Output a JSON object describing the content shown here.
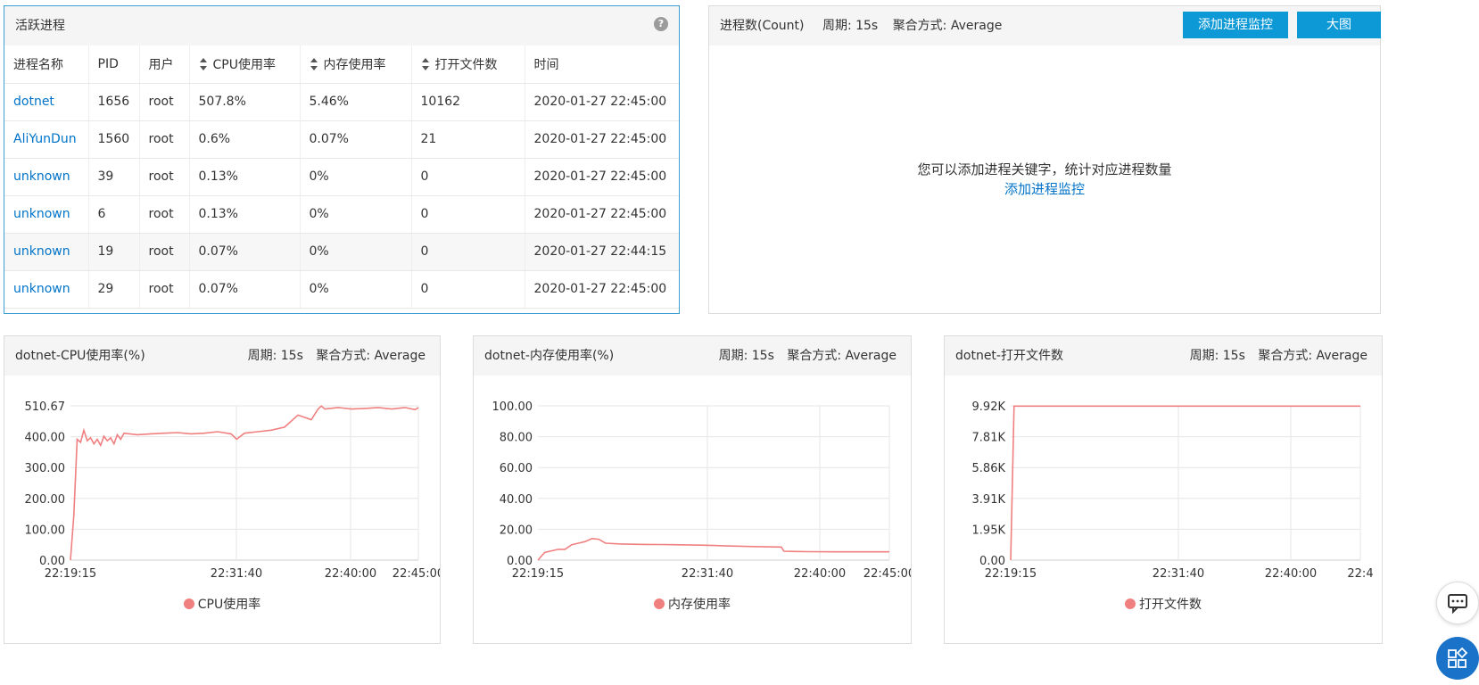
{
  "process_panel": {
    "title": "活跃进程",
    "help": "?",
    "columns": [
      "进程名称",
      "PID",
      "用户",
      "CPU使用率",
      "内存使用率",
      "打开文件数",
      "时间"
    ],
    "rows": [
      {
        "name": "dotnet",
        "pid": "1656",
        "user": "root",
        "cpu": "507.8%",
        "mem": "5.46%",
        "files": "10162",
        "time": "2020-01-27 22:45:00"
      },
      {
        "name": "AliYunDun",
        "pid": "1560",
        "user": "root",
        "cpu": "0.6%",
        "mem": "0.07%",
        "files": "21",
        "time": "2020-01-27 22:45:00"
      },
      {
        "name": "unknown",
        "pid": "39",
        "user": "root",
        "cpu": "0.13%",
        "mem": "0%",
        "files": "0",
        "time": "2020-01-27 22:45:00"
      },
      {
        "name": "unknown",
        "pid": "6",
        "user": "root",
        "cpu": "0.13%",
        "mem": "0%",
        "files": "0",
        "time": "2020-01-27 22:45:00"
      },
      {
        "name": "unknown",
        "pid": "19",
        "user": "root",
        "cpu": "0.07%",
        "mem": "0%",
        "files": "0",
        "time": "2020-01-27 22:44:15"
      },
      {
        "name": "unknown",
        "pid": "29",
        "user": "root",
        "cpu": "0.07%",
        "mem": "0%",
        "files": "0",
        "time": "2020-01-27 22:45:00"
      }
    ]
  },
  "count_panel": {
    "title": "进程数(Count)",
    "period": "周期: 15s",
    "agg": "聚合方式: Average",
    "add_button": "添加进程监控",
    "big_button": "大图",
    "empty_text": "您可以添加进程关键字，统计对应进程数量",
    "empty_link": "添加进程监控"
  },
  "charts": [
    {
      "title": "dotnet-CPU使用率(%)",
      "period": "周期: 15s",
      "agg": "聚合方式: Average",
      "legend": "CPU使用率"
    },
    {
      "title": "dotnet-内存使用率(%)",
      "period": "周期: 15s",
      "agg": "聚合方式: Average",
      "legend": "内存使用率"
    },
    {
      "title": "dotnet-打开文件数",
      "period": "周期: 15s",
      "agg": "聚合方式: Average",
      "legend": "打开文件数"
    }
  ],
  "colors": {
    "series": "#f08080",
    "accent": "#0d99d6",
    "link": "#0073c8"
  },
  "icons": {
    "help": "help-icon",
    "sort": "sort-icon",
    "chat": "chat-icon",
    "apps": "apps-icon"
  },
  "chart_data": [
    {
      "type": "line",
      "title": "dotnet-CPU使用率(%)",
      "x_ticks": [
        "22:19:15",
        "22:31:40",
        "22:40:00",
        "22:45:00"
      ],
      "y_ticks": [
        "0.00",
        "100.00",
        "200.00",
        "300.00",
        "400.00",
        "510.67"
      ],
      "ylim": [
        0,
        510.67
      ],
      "grid": true,
      "legend_position": "bottom",
      "series": [
        {
          "name": "CPU使用率",
          "x_minutes": [
            0,
            0.25,
            0.5,
            0.75,
            1.0,
            1.25,
            1.5,
            1.75,
            2.0,
            2.25,
            2.5,
            2.75,
            3.0,
            3.25,
            3.5,
            3.75,
            4,
            5,
            6,
            7,
            8,
            9,
            10,
            11,
            12,
            12.42,
            13,
            14,
            15,
            16,
            17,
            18,
            18.5,
            18.75,
            19,
            20,
            21,
            22,
            23,
            24,
            25,
            25.75,
            26
          ],
          "values": [
            0,
            150,
            400,
            390,
            430,
            395,
            405,
            385,
            400,
            380,
            410,
            395,
            405,
            385,
            415,
            400,
            420,
            415,
            418,
            420,
            422,
            418,
            420,
            425,
            418,
            400,
            420,
            425,
            430,
            440,
            480,
            465,
            500,
            510,
            500,
            505,
            500,
            502,
            505,
            500,
            505,
            498,
            505
          ]
        }
      ]
    },
    {
      "type": "line",
      "title": "dotnet-内存使用率(%)",
      "x_ticks": [
        "22:19:15",
        "22:31:40",
        "22:40:00",
        "22:45:00"
      ],
      "y_ticks": [
        "0.00",
        "20.00",
        "40.00",
        "60.00",
        "80.00",
        "100.00"
      ],
      "ylim": [
        0,
        100
      ],
      "grid": true,
      "legend_position": "bottom",
      "series": [
        {
          "name": "内存使用率",
          "x_minutes": [
            0,
            0.5,
            1,
            1.5,
            2,
            2.5,
            3,
            3.5,
            4,
            4.5,
            5,
            6,
            7,
            8,
            9,
            10,
            11,
            12,
            13,
            14,
            15,
            16,
            17,
            18,
            18.2,
            19,
            20,
            22,
            24,
            26
          ],
          "values": [
            0,
            5,
            6,
            7,
            7,
            10,
            11,
            12,
            14,
            13.5,
            11,
            10.5,
            10.3,
            10.2,
            10.1,
            10,
            9.9,
            9.7,
            9.5,
            9.2,
            9,
            8.8,
            8.6,
            8.5,
            5.8,
            5.6,
            5.5,
            5.4,
            5.4,
            5.4
          ]
        }
      ]
    },
    {
      "type": "line",
      "title": "dotnet-打开文件数",
      "x_ticks": [
        "22:19:15",
        "22:31:40",
        "22:40:00",
        "22:4"
      ],
      "y_ticks": [
        "0.00",
        "1.95K",
        "3.91K",
        "5.86K",
        "7.81K",
        "9.92K"
      ],
      "ylim": [
        0,
        9920
      ],
      "grid": true,
      "legend_position": "bottom",
      "series": [
        {
          "name": "打开文件数",
          "x_minutes": [
            0,
            0.25,
            26
          ],
          "values": [
            0,
            9900,
            9900
          ]
        }
      ]
    }
  ]
}
